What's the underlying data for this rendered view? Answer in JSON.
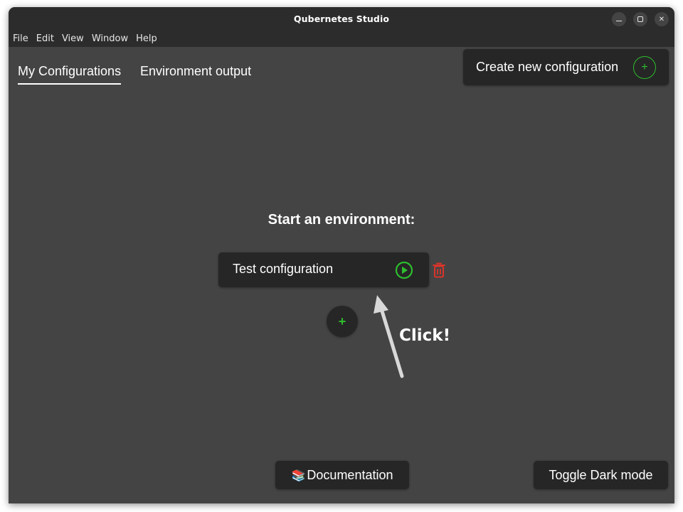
{
  "window": {
    "title": "Qubernetes Studio",
    "minimize_symbol": "–",
    "close_symbol": "✕"
  },
  "menu": {
    "items": [
      "File",
      "Edit",
      "View",
      "Window",
      "Help"
    ]
  },
  "tabs": [
    {
      "label": "My Configurations",
      "active": true
    },
    {
      "label": "Environment output",
      "active": false
    }
  ],
  "create_button": {
    "label": "Create new configuration",
    "icon": "plus-circle-icon",
    "symbol": "+"
  },
  "main": {
    "heading": "Start an environment:",
    "configurations": [
      {
        "name": "Test configuration",
        "run_icon": "play-circle-icon",
        "delete_icon": "trash-icon"
      }
    ],
    "add_symbol": "+"
  },
  "annotation": {
    "text": "Click!"
  },
  "footer": {
    "documentation_icon": "📚",
    "documentation_label": "Documentation",
    "dark_mode_label": "Toggle Dark mode"
  },
  "colors": {
    "window_bg": "#444444",
    "titlebar_bg": "#2c2c2c",
    "card_bg": "#262626",
    "accent_green": "#2dbe2d",
    "delete_red": "#d9352a"
  }
}
